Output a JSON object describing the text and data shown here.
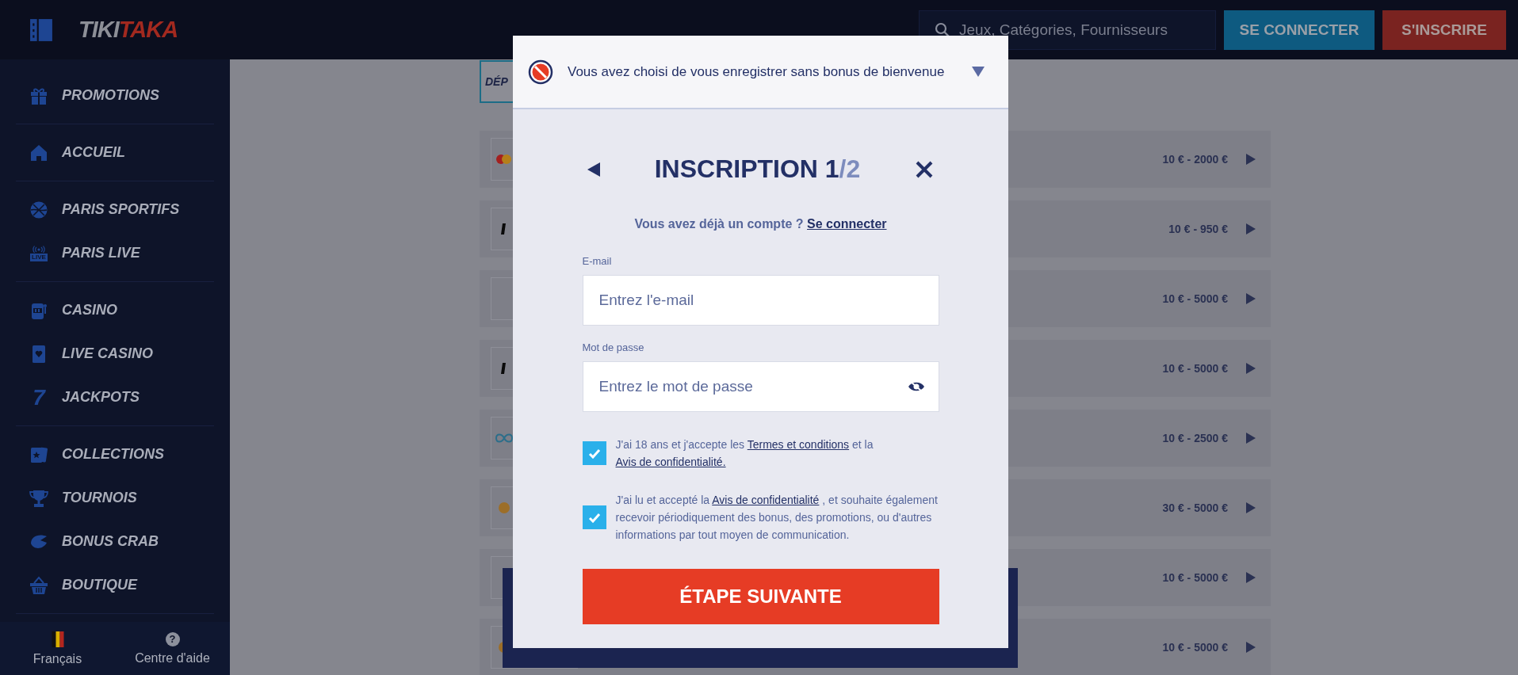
{
  "header": {
    "logo": {
      "part_1": "TIKI",
      "part_2": "TAKA"
    },
    "search": {
      "placeholder": "Jeux, Catégories, Fournisseurs"
    },
    "buttons": [
      {
        "label": "SE CONNECTER",
        "kind": "login"
      },
      {
        "label": "S'INSCRIRE",
        "kind": "signup"
      }
    ]
  },
  "sidebar": {
    "groups": [
      [
        {
          "label": "PROMOTIONS"
        }
      ],
      [
        {
          "label": "ACCUEIL"
        }
      ],
      [
        {
          "label": "PARIS SPORTIFS"
        },
        {
          "label": "PARIS LIVE",
          "icon_text": "LIVE"
        }
      ],
      [
        {
          "label": "CASINO"
        },
        {
          "label": "LIVE CASINO"
        },
        {
          "label": "JACKPOTS",
          "icon_text": "7"
        }
      ],
      [
        {
          "label": "COLLECTIONS"
        },
        {
          "label": "TOURNOIS"
        },
        {
          "label": "BONUS CRAB"
        },
        {
          "label": "BOUTIQUE"
        }
      ]
    ],
    "footer": [
      {
        "label": "Français",
        "kind": "flag"
      },
      {
        "label": "Centre d'aide",
        "kind": "help",
        "icon_text": "?"
      }
    ]
  },
  "content": {
    "tab": "DÉP",
    "methods": [
      {
        "amount": "10 € - 2000 €"
      },
      {
        "amount": "10 € - 950 €"
      },
      {
        "amount": "10 € - 5000 €"
      },
      {
        "amount": "10 € - 5000 €"
      },
      {
        "amount": "10 € - 2500 €"
      },
      {
        "amount": "30 € - 5000 €"
      },
      {
        "amount": "10 € - 5000 €"
      },
      {
        "amount": "10 € - 5000 €"
      }
    ]
  },
  "modal": {
    "notice": "Vous avez choisi de vous enregistrer sans bonus de bienvenue",
    "title": "INSCRIPTION 1",
    "title_step": "/2",
    "login_prompt": {
      "text": "Vous avez déjà un compte ?",
      "link": "Se connecter"
    },
    "fields": [
      {
        "label": "E-mail",
        "placeholder": "Entrez l'e-mail",
        "kind": "email"
      },
      {
        "label": "Mot de passe",
        "placeholder": "Entrez le mot de passe",
        "kind": "password"
      }
    ],
    "consents": [
      {
        "checked": true,
        "parts": [
          {
            "text": "J'ai 18 ans et j'accepte les ",
            "link": false
          },
          {
            "text": "Termes et conditions",
            "link": true
          },
          {
            "text": " et la ",
            "link": false
          },
          {
            "text": "Avis de confidentialité.",
            "link": true
          }
        ]
      },
      {
        "checked": true,
        "parts": [
          {
            "text": "J'ai lu et accepté la ",
            "link": false
          },
          {
            "text": "Avis de confidentialité",
            "link": true
          },
          {
            "text": " , et souhaite également recevoir périodiquement des bonus, des promotions, ou d'autres informations par tout moyen de communication.",
            "link": false
          }
        ]
      }
    ],
    "submit": "ÉTAPE SUIVANTE"
  }
}
